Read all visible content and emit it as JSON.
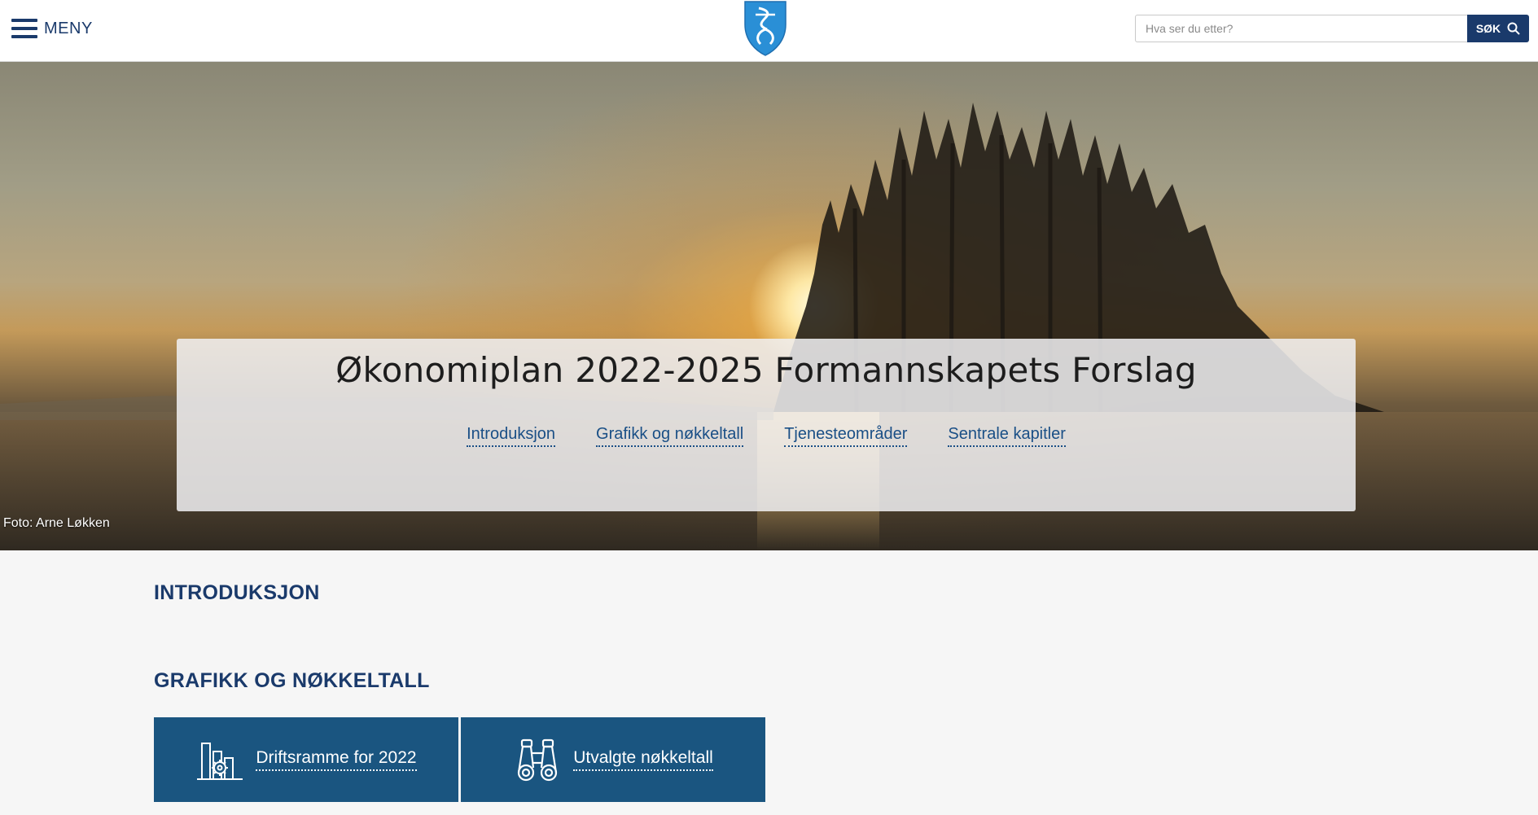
{
  "header": {
    "menu_label": "MENY",
    "search": {
      "placeholder": "Hva ser du etter?",
      "value": "",
      "button_label": "SØK"
    }
  },
  "hero": {
    "title": "Økonomiplan 2022-2025 Formannskapets Forslag",
    "links": [
      {
        "label": "Introduksjon"
      },
      {
        "label": "Grafikk og nøkkeltall"
      },
      {
        "label": "Tjenesteområder"
      },
      {
        "label": "Sentrale kapitler"
      }
    ],
    "photo_credit": "Foto: Arne Løkken"
  },
  "sections": [
    {
      "title": "INTRODUKSJON"
    },
    {
      "title": "GRAFIKK OG NØKKELTALL"
    }
  ],
  "tiles": [
    {
      "label": "Driftsramme for 2022",
      "icon": "chart-gear-icon"
    },
    {
      "label": "Utvalgte nøkkeltall",
      "icon": "binoculars-icon"
    }
  ],
  "colors": {
    "brand": "#1a3a6b",
    "tile": "#1a5580",
    "link": "#1a4f86"
  }
}
